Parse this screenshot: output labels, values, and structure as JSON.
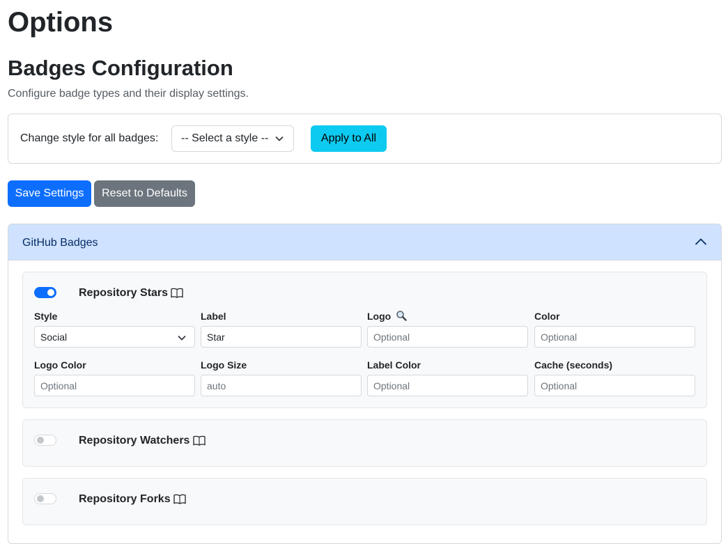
{
  "page": {
    "title": "Options",
    "section_title": "Badges Configuration",
    "description": "Configure badge types and their display settings."
  },
  "style_bar": {
    "label": "Change style for all badges:",
    "select_value": "-- Select a style --",
    "apply_label": "Apply to All"
  },
  "actions": {
    "save_label": "Save Settings",
    "reset_label": "Reset to Defaults"
  },
  "accordion": {
    "title": "GitHub Badges",
    "expanded": true
  },
  "badges": [
    {
      "name": "Repository Stars",
      "enabled": true,
      "fields": {
        "style": {
          "label": "Style",
          "value": "Social"
        },
        "label": {
          "label": "Label",
          "value": "Star"
        },
        "logo": {
          "label": "Logo",
          "placeholder": "Optional"
        },
        "color": {
          "label": "Color",
          "placeholder": "Optional"
        },
        "logo_color": {
          "label": "Logo Color",
          "placeholder": "Optional"
        },
        "logo_size": {
          "label": "Logo Size",
          "value": "auto"
        },
        "label_color": {
          "label": "Label Color",
          "placeholder": "Optional"
        },
        "cache": {
          "label": "Cache (seconds)",
          "placeholder": "Optional"
        }
      }
    },
    {
      "name": "Repository Watchers",
      "enabled": false
    },
    {
      "name": "Repository Forks",
      "enabled": false
    }
  ],
  "icons": {
    "docs": "book-icon",
    "logo_search": "magnifier-icon",
    "collapse": "chevron-up-icon",
    "select": "chevron-down-icon"
  },
  "colors": {
    "primary": "#0d6efd",
    "info": "#0dcaf0",
    "secondary": "#6c757d",
    "accordion_header": "#cfe2ff"
  }
}
